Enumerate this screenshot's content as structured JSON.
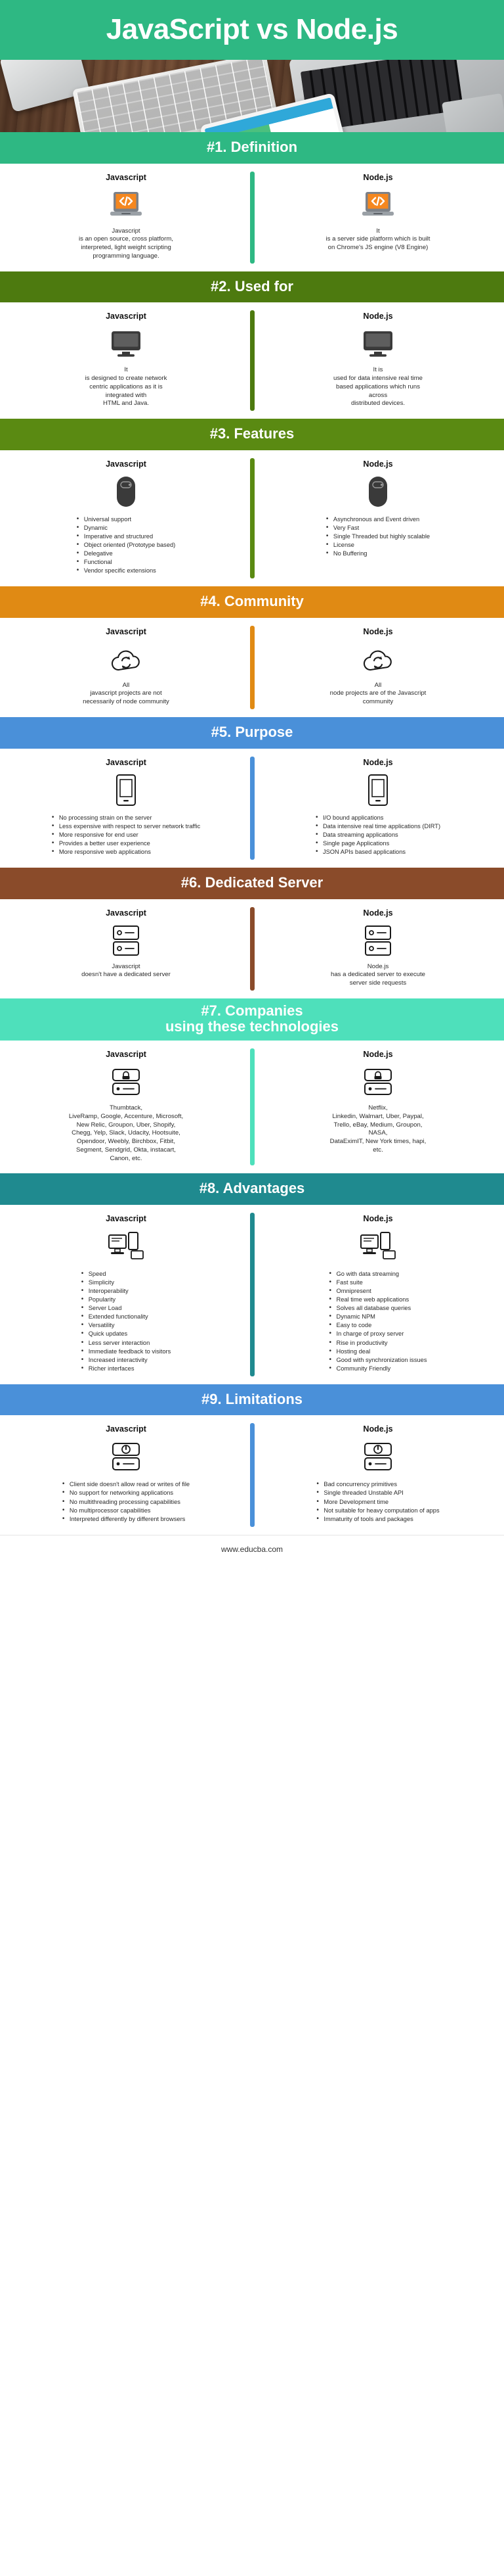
{
  "header": {
    "title": "JavaScript vs Node.js"
  },
  "labels": {
    "js": "Javascript",
    "node": "Node.js"
  },
  "colors": {
    "header_green": "#2eb883",
    "definition_green": "#2eb883",
    "used_for_green": "#4d7a0f",
    "features_green": "#5a8a12",
    "community_orange": "#e08a14",
    "purpose_blue": "#4a90d9",
    "server_brown": "#8a4b2a",
    "companies_teal": "#4ee0bb",
    "advantages_teal": "#1f8a8f",
    "limitations_blue": "#4a90d9",
    "icon_orange": "#f5871f"
  },
  "sections": [
    {
      "id": "definition",
      "band": "#1. Definition",
      "band_color": "#2eb883",
      "divider_color": "#2eb883",
      "icon": "code-laptop-icon",
      "js": {
        "text": "Javascript\nis an open source, cross platform,\ninterpreted, light weight scripting\nprogramming language."
      },
      "node": {
        "text": "It\nis a server side platform which is built\non Chrome's JS engine (V8 Engine)"
      }
    },
    {
      "id": "used-for",
      "band": "#2. Used for",
      "band_color": "#4d7a0f",
      "divider_color": "#4d7a0f",
      "icon": "monitor-icon",
      "js": {
        "text": "It\nis designed to create network\ncentric applications as it is\nintegrated with\nHTML and Java."
      },
      "node": {
        "text": "It is\nused for data intensive real time\nbased applications which runs\nacross\ndistributed devices."
      }
    },
    {
      "id": "features",
      "band": "#3. Features",
      "band_color": "#5a8a12",
      "divider_color": "#5a8a12",
      "icon": "mouse-icon",
      "js": {
        "bullets": [
          "Universal support",
          "Dynamic",
          "Imperative and structured",
          "Object oriented (Prototype based)",
          "Delegative",
          "Functional",
          "Vendor specific extensions"
        ]
      },
      "node": {
        "bullets": [
          "Asynchronous and Event driven",
          "Very Fast",
          "Single Threaded but highly scalable",
          "License",
          "No Buffering"
        ]
      }
    },
    {
      "id": "community",
      "band": "#4. Community",
      "band_color": "#e08a14",
      "divider_color": "#e08a14",
      "icon": "cloud-sync-icon",
      "js": {
        "text": "All\njavascript projects are not\nnecessarily of node community"
      },
      "node": {
        "text": "All\nnode projects are of the Javascript\ncommunity"
      }
    },
    {
      "id": "purpose",
      "band": "#5. Purpose",
      "band_color": "#4a90d9",
      "divider_color": "#4a90d9",
      "icon": "device-icon",
      "js": {
        "bullets": [
          "No processing strain on the server",
          "Less expensive with respect to server network traffic",
          "More responsive for end user",
          "Provides a better user experience",
          "More responsive web applications"
        ]
      },
      "node": {
        "bullets": [
          "I/O bound applications",
          "Data intensive real time applications (DIRT)",
          "Data streaming applications",
          "Single page Applications",
          "JSON APIs based applications"
        ]
      }
    },
    {
      "id": "dedicated-server",
      "band": "#6. Dedicated Server",
      "band_color": "#8a4b2a",
      "divider_color": "#8a4b2a",
      "icon": "server-icon",
      "js": {
        "text": "Javascript\ndoesn't have a dedicated server"
      },
      "node": {
        "text": "Node.js\nhas a dedicated server to execute\nserver side requests"
      }
    },
    {
      "id": "companies",
      "band": "#7. Companies\nusing these technologies",
      "band_color": "#4ee0bb",
      "divider_color": "#4ee0bb",
      "icon": "server-lock-icon",
      "js": {
        "text": "Thumbtack,\nLiveRamp, Google, Accenture, Microsoft,\nNew Relic, Groupon, Uber, Shopify,\nChegg, Yelp, Slack, Udacity, Hootsuite,\nOpendoor, Weebly, Birchbox, Fitbit,\nSegment, Sendgrid, Okta, instacart,\nCanon, etc."
      },
      "node": {
        "text": "Netflix,\nLinkedin, Walmart, Uber, Paypal,\nTrello, eBay, Medium, Groupon,\nNASA,\nDataEximIT, New York times, hapi,\netc."
      }
    },
    {
      "id": "advantages",
      "band": "#8. Advantages",
      "band_color": "#1f8a8f",
      "divider_color": "#1f8a8f",
      "icon": "desktop-devices-icon",
      "js": {
        "bullets": [
          "Speed",
          "Simplicity",
          "Interoperability",
          "Popularity",
          "Server Load",
          "Extended functionality",
          "Versatility",
          "Quick updates",
          "Less server interaction",
          "Immediate feedback to visitors",
          "Increased interactivity",
          "Richer interfaces"
        ]
      },
      "node": {
        "bullets": [
          "Go with data streaming",
          "Fast suite",
          "Omnipresent",
          "Real time web applications",
          "Solves all database queries",
          "Dynamic NPM",
          "Easy to code",
          "In charge of proxy server",
          "Rise in productivity",
          "Hosting deal",
          "Good with synchronization issues",
          "Community Friendly"
        ]
      }
    },
    {
      "id": "limitations",
      "band": "#9. Limitations",
      "band_color": "#4a90d9",
      "divider_color": "#4a90d9",
      "icon": "power-server-icon",
      "js": {
        "bullets": [
          "Client side doesn't allow read or writes of file",
          "No support for networking applications",
          "No multithreading processing capabilities",
          "No multiprocessor capabilities",
          "Interpreted differently by different browsers"
        ]
      },
      "node": {
        "bullets": [
          "Bad concurrency primitives",
          "Single threaded Unstable API",
          "More Development time",
          "Not suitable for heavy computation of apps",
          "Immaturity of tools and packages"
        ]
      }
    }
  ],
  "footer": {
    "url": "www.educba.com"
  }
}
